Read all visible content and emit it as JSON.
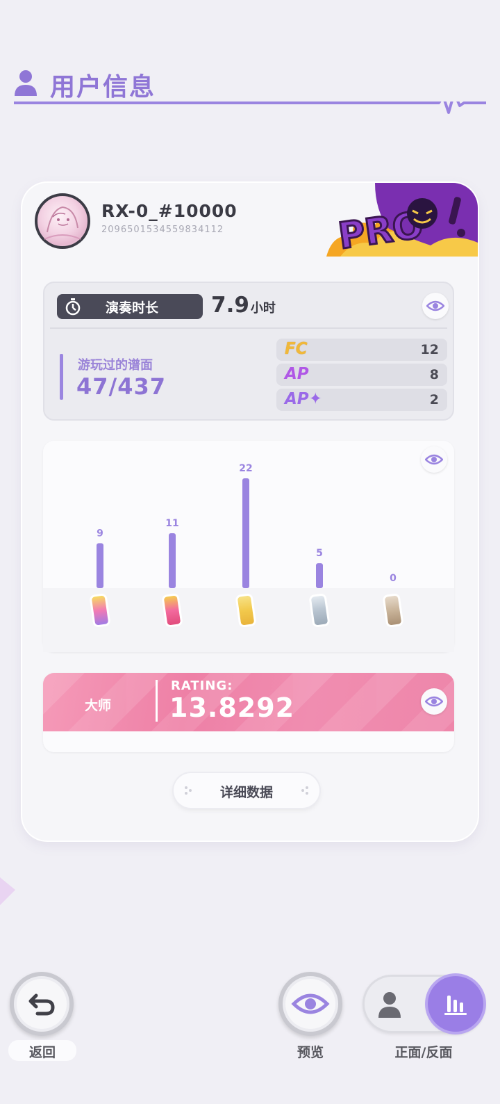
{
  "header": {
    "title": "用户信息",
    "icon": "user-icon"
  },
  "profile": {
    "name": "RX-0_#10000",
    "id": "2096501534559834112",
    "badge": "PRO"
  },
  "playtime": {
    "label": "演奏时长",
    "value": "7.9",
    "unit": "小时"
  },
  "charts_played": {
    "label": "游玩过的谱面",
    "value": "47/437"
  },
  "clear_types": [
    {
      "tag": "FC",
      "count": "12"
    },
    {
      "tag": "AP",
      "count": "8"
    },
    {
      "tag": "AP✦",
      "count": "2"
    }
  ],
  "chart_data": {
    "type": "bar",
    "categories": [
      "rainbow",
      "gradient",
      "gold",
      "silver",
      "bronze"
    ],
    "values": [
      9,
      11,
      22,
      5,
      0
    ],
    "ylim": [
      0,
      22
    ],
    "grid": false,
    "colors": [
      "#9a84e0"
    ]
  },
  "rating": {
    "rank": "大师",
    "caption": "RATING:",
    "value": "13.8292"
  },
  "detail_button": "详细数据",
  "bottom": {
    "back": "返回",
    "preview": "预览",
    "flip": "正面/反面"
  },
  "colors": {
    "accent": "#8f76d6",
    "rating_pink": "#ee86aa",
    "bar": "#9a84e0"
  }
}
